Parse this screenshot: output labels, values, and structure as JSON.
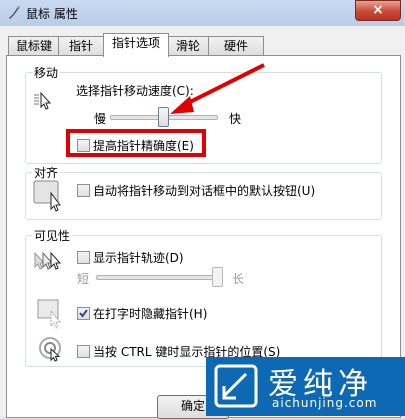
{
  "window": {
    "title": "鼠标 属性",
    "close_glyph": "×"
  },
  "tabs": [
    {
      "label": "鼠标键"
    },
    {
      "label": "指针"
    },
    {
      "label": "指针选项"
    },
    {
      "label": "滑轮"
    },
    {
      "label": "硬件"
    }
  ],
  "active_tab": "指针选项",
  "motion": {
    "group_label": "移动",
    "speed_label": "选择指针移动速度(C):",
    "slow": "慢",
    "fast": "快",
    "speed_level": 0.5,
    "precision_label": "提高指针精确度(E)",
    "precision_checked": false
  },
  "snap": {
    "group_label": "对齐",
    "snap_label": "自动将指针移动到对话框中的默认按钮(U)",
    "snap_checked": false
  },
  "visibility": {
    "group_label": "可见性",
    "trails_label": "显示指针轨迹(D)",
    "trails_checked": false,
    "short": "短",
    "long": "长",
    "trail_length_level": 1.0,
    "hide_label": "在打字时隐藏指针(H)",
    "hide_checked": true,
    "ctrl_label": "当按 CTRL 键时显示指针的位置(S)",
    "ctrl_checked": false
  },
  "buttons": {
    "ok": "确定"
  },
  "watermark": {
    "text": "爱纯净",
    "url": "aichunjing.com"
  },
  "colors": {
    "annotation_red": "#e10000",
    "watermark_blue": "#0d69b3"
  }
}
